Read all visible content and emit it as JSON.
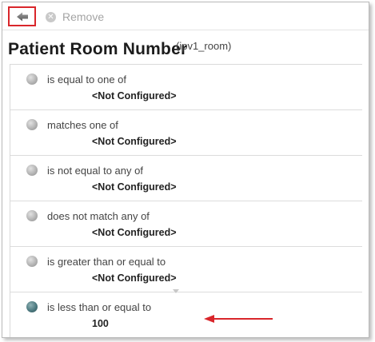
{
  "toolbar": {
    "back_icon": "back-arrow-icon",
    "remove_icon": "remove-circle-icon",
    "remove_label": "Remove",
    "highlight_color": "#d9262b"
  },
  "header": {
    "title": "Patient Room Number",
    "field_id": "(ipv1_room)"
  },
  "operators": [
    {
      "label": "is equal to one of",
      "value": "<Not Configured>",
      "selected": false
    },
    {
      "label": "matches one of",
      "value": "<Not Configured>",
      "selected": false
    },
    {
      "label": "is not equal to any of",
      "value": "<Not Configured>",
      "selected": false
    },
    {
      "label": "does not match any of",
      "value": "<Not Configured>",
      "selected": false
    },
    {
      "label": "is greater than or equal to",
      "value": "<Not Configured>",
      "selected": false
    },
    {
      "label": "is less than or equal to",
      "value": "100",
      "selected": true
    }
  ],
  "annotation": {
    "arrow_color": "#d9262b"
  }
}
